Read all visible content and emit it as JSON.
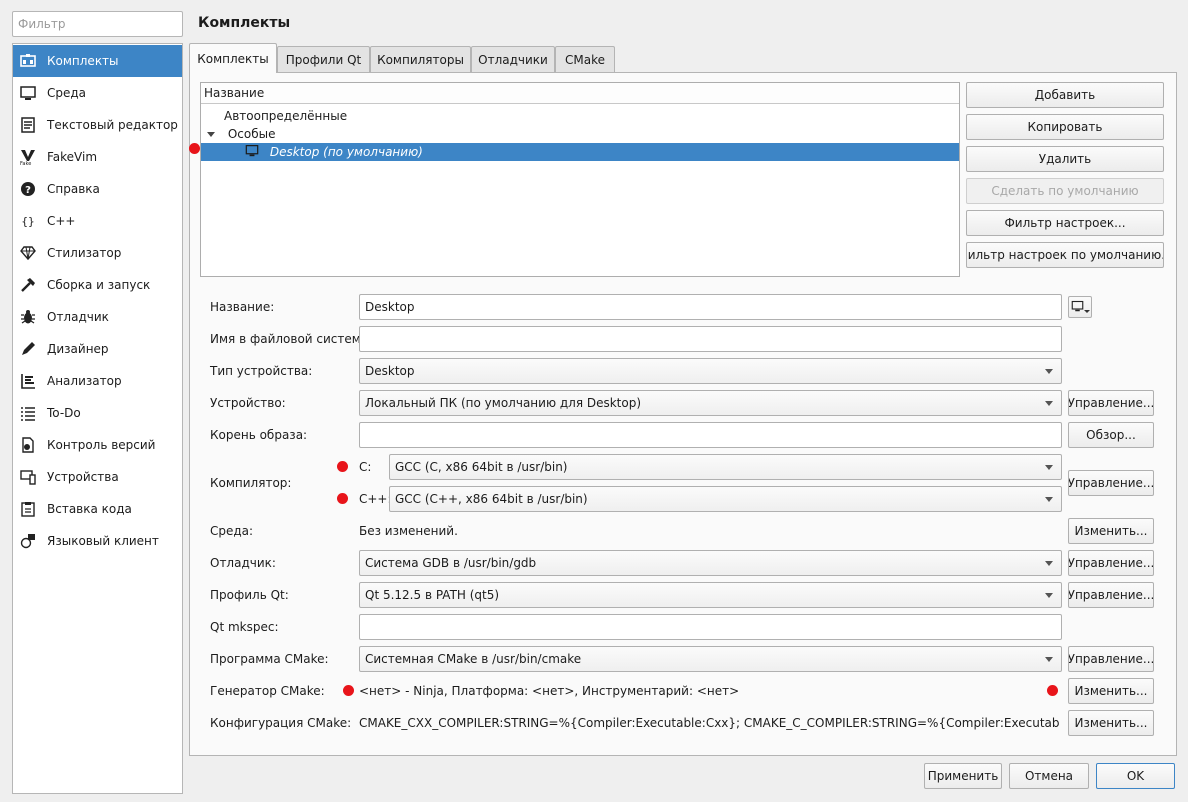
{
  "search": {
    "placeholder": "Фильтр"
  },
  "sidebar": {
    "items": [
      {
        "label": "Комплекты",
        "icon": "kits-icon"
      },
      {
        "label": "Среда",
        "icon": "monitor-icon"
      },
      {
        "label": "Текстовый редактор",
        "icon": "text-editor-icon"
      },
      {
        "label": "FakeVim",
        "icon": "fakevim-icon"
      },
      {
        "label": "Справка",
        "icon": "help-icon"
      },
      {
        "label": "C++",
        "icon": "cpp-braces-icon"
      },
      {
        "label": "Стилизатор",
        "icon": "diamond-icon"
      },
      {
        "label": "Сборка и запуск",
        "icon": "hammer-icon"
      },
      {
        "label": "Отладчик",
        "icon": "bug-icon"
      },
      {
        "label": "Дизайнер",
        "icon": "pen-icon"
      },
      {
        "label": "Анализатор",
        "icon": "analyzer-icon"
      },
      {
        "label": "To-Do",
        "icon": "todo-list-icon"
      },
      {
        "label": "Контроль версий",
        "icon": "version-control-icon"
      },
      {
        "label": "Устройства",
        "icon": "devices-icon"
      },
      {
        "label": "Вставка кода",
        "icon": "code-paste-icon"
      },
      {
        "label": "Языковый клиент",
        "icon": "language-client-icon"
      }
    ]
  },
  "header": {
    "title": "Комплекты"
  },
  "tabs": [
    {
      "label": "Комплекты",
      "active": true
    },
    {
      "label": "Профили Qt",
      "active": false
    },
    {
      "label": "Компиляторы",
      "active": false
    },
    {
      "label": "Отладчики",
      "active": false
    },
    {
      "label": "CMake",
      "active": false
    }
  ],
  "tree": {
    "column_header": "Название",
    "rows": [
      {
        "label": "Автоопределённые"
      },
      {
        "label": "Особые",
        "expanded": true
      },
      {
        "label": "Desktop (по умолчанию)",
        "selected": true,
        "icon": "monitor-icon"
      }
    ]
  },
  "kit_buttons": {
    "add": "Добавить",
    "copy": "Копировать",
    "remove": "Удалить",
    "make_default": "Сделать по умолчанию",
    "filter": "Фильтр настроек...",
    "default_filter": "Фильтр настроек по умолчанию..."
  },
  "form": {
    "name": {
      "label": "Название:",
      "value": "Desktop"
    },
    "fs_name": {
      "label": "Имя в файловой системе:",
      "value": ""
    },
    "device_type": {
      "label": "Тип устройства:",
      "value": "Desktop"
    },
    "device": {
      "label": "Устройство:",
      "value": "Локальный ПК (по умолчанию для Desktop)",
      "button": "Управление..."
    },
    "sysroot": {
      "label": "Корень образа:",
      "value": "",
      "button": "Обзор..."
    },
    "compiler": {
      "label": "Компилятор:",
      "c_label": "C:",
      "c_value": "GCC (C, x86 64bit в /usr/bin)",
      "cpp_label": "C++:",
      "cpp_value": "GCC (C++, x86 64bit в /usr/bin)",
      "button": "Управление..."
    },
    "environment": {
      "label": "Среда:",
      "value": "Без изменений.",
      "button": "Изменить..."
    },
    "debugger": {
      "label": "Отладчик:",
      "value": "Система GDB в /usr/bin/gdb",
      "button": "Управление..."
    },
    "qt_version": {
      "label": "Профиль Qt:",
      "value": "Qt 5.12.5 в PATH (qt5)",
      "button": "Управление..."
    },
    "qt_mkspec": {
      "label": "Qt mkspec:",
      "value": ""
    },
    "cmake_tool": {
      "label": "Программа CMake:",
      "value": "Системная CMake в /usr/bin/cmake",
      "button": "Управление..."
    },
    "cmake_generator": {
      "label": "Генератор CMake:",
      "value": "<нет> - Ninja, Платформа: <нет>, Инструментарий: <нет>",
      "button": "Изменить..."
    },
    "cmake_config": {
      "label": "Конфигурация CMake:",
      "value": "CMAKE_CXX_COMPILER:STRING=%{Compiler:Executable:Cxx}; CMAKE_C_COMPILER:STRING=%{Compiler:Executable:C}; CM...",
      "button": "Изменить..."
    }
  },
  "dialog_buttons": {
    "apply": "Применить",
    "cancel": "Отмена",
    "ok": "OK"
  },
  "colors": {
    "selection": "#3d85c6",
    "marker": "#e8141a"
  }
}
